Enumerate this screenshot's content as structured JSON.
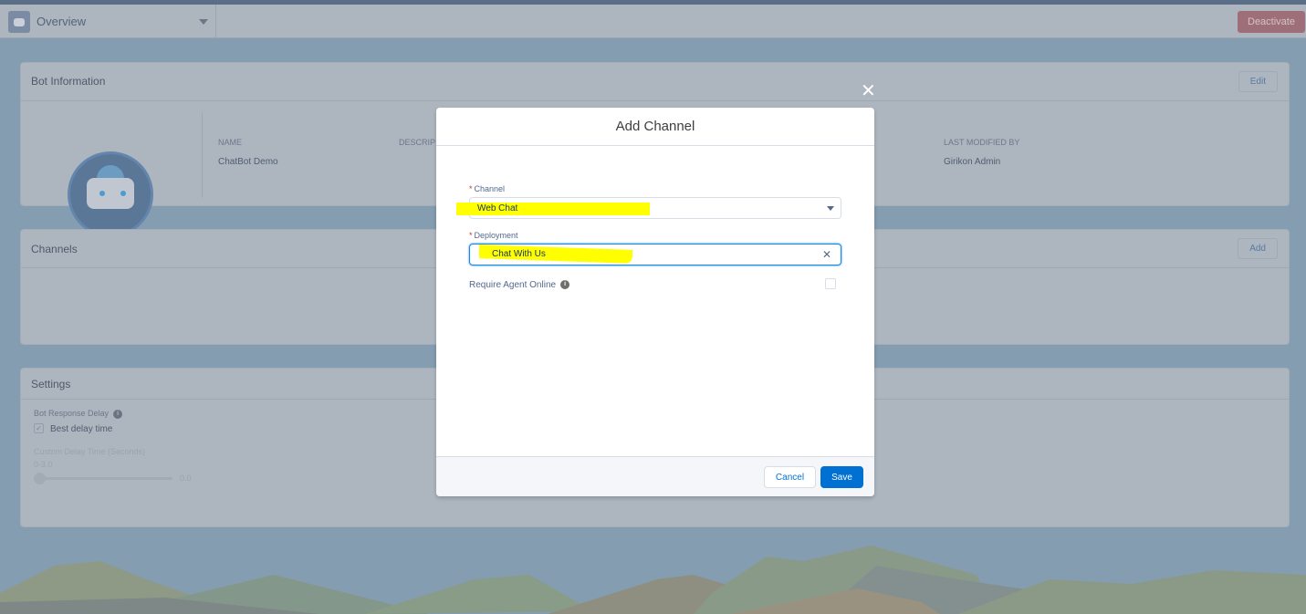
{
  "header": {
    "title": "Overview",
    "deactivate_label": "Deactivate"
  },
  "bot_info": {
    "title": "Bot Information",
    "edit_label": "Edit",
    "name_label": "NAME",
    "name_value": "ChatBot Demo",
    "description_label": "DESCRIP",
    "last_modified_label": "LAST MODIFIED BY",
    "last_modified_value": "Girikon Admin"
  },
  "channels": {
    "title": "Channels",
    "add_label": "Add"
  },
  "settings": {
    "title": "Settings",
    "delay_label": "Bot Response Delay",
    "best_delay_label": "Best delay time",
    "best_delay_checked": true,
    "custom_delay_label": "Custom Delay Time (Seconds)",
    "range_label": "0-3.0",
    "slider_value": "0.0"
  },
  "modal": {
    "title": "Add Channel",
    "channel_label": "Channel",
    "channel_value": "Web Chat",
    "deployment_label": "Deployment",
    "deployment_value": "Chat With Us",
    "require_agent_label": "Require Agent Online",
    "require_agent_checked": false,
    "required_mark": "*",
    "cancel_label": "Cancel",
    "save_label": "Save",
    "close_glyph": "✕",
    "clear_glyph": "✕",
    "info_glyph": "i"
  },
  "colors": {
    "brand": "#0070d2",
    "highlight": "#ffff00",
    "deactivate": "#c23934"
  }
}
